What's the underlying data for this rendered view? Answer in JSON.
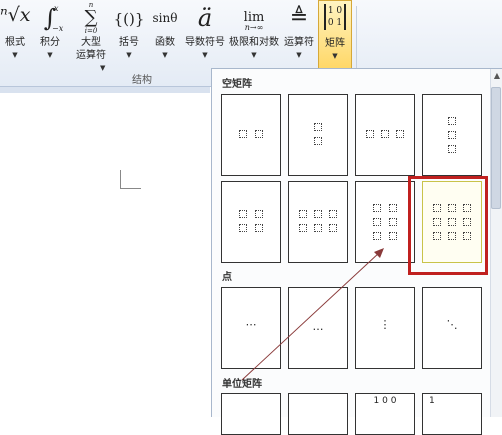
{
  "ribbon": {
    "tools": [
      {
        "name": "radical-button",
        "glyph": "ⁿ√x",
        "label": "根式"
      },
      {
        "name": "integral-button",
        "glyph": "∫",
        "label": "积分"
      },
      {
        "name": "large-operator-button",
        "glyph": "∑",
        "label": "大型运算符"
      },
      {
        "name": "bracket-button",
        "glyph": "{()}",
        "label": "括号"
      },
      {
        "name": "function-button",
        "glyph": "sinθ",
        "label": "函数"
      },
      {
        "name": "accent-button",
        "glyph": "ä",
        "label": "导数符号"
      },
      {
        "name": "limit-log-button",
        "glyph": "lim",
        "label": "极限和对数"
      },
      {
        "name": "operator-button",
        "glyph": "≜",
        "label": "运算符"
      },
      {
        "name": "matrix-button",
        "glyph": "[10 01]",
        "label": "矩阵"
      }
    ],
    "group_label": "结构",
    "large_op_line1": "大型",
    "large_op_line2": "运算符",
    "integral_sup": "x",
    "integral_sub": "−x",
    "sum_sup": "n",
    "sum_sub": "i=0",
    "lim_sub": "n→∞",
    "matrix_glyph_row1": "1 0",
    "matrix_glyph_row2": "0 1"
  },
  "panel": {
    "sections": {
      "empty_matrix": "空矩阵",
      "dots": "点",
      "identity": "单位矩阵"
    },
    "dot_glyphs": [
      "⋯",
      "…",
      "⋮",
      "⋱"
    ],
    "identity_preview": "1  0  0",
    "identity_preview_b": "1"
  }
}
